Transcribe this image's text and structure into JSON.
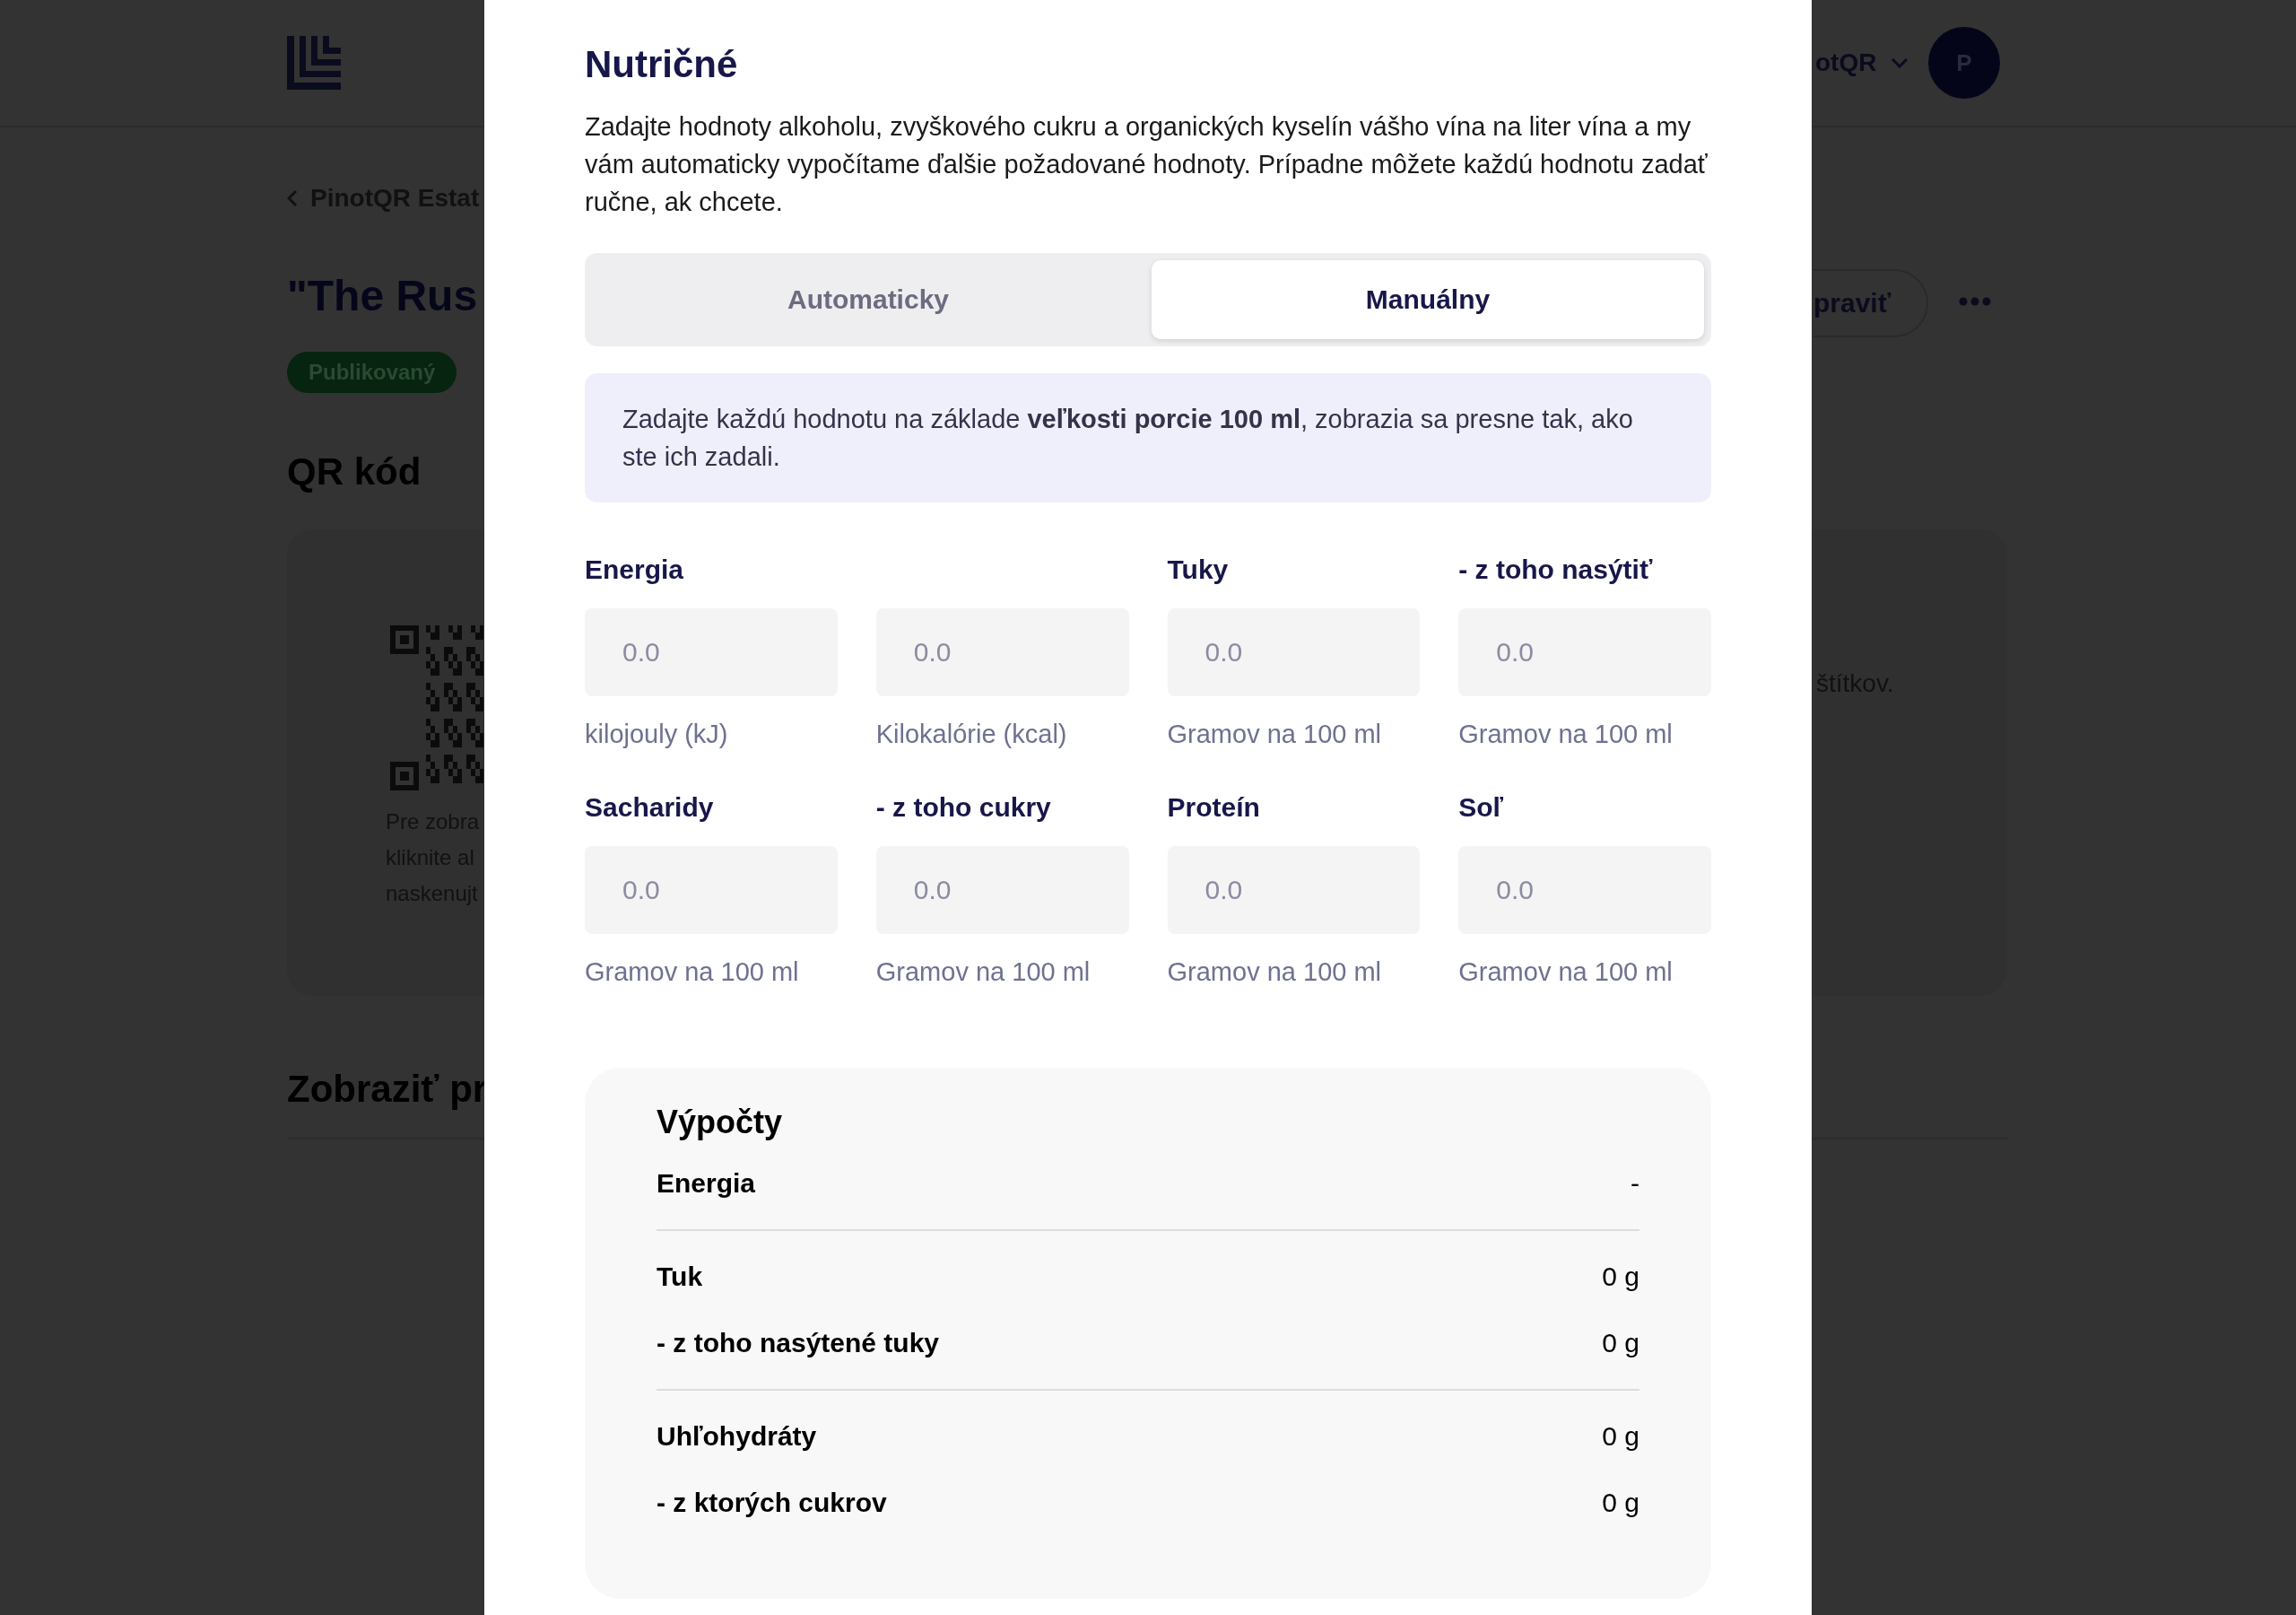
{
  "background": {
    "header": {
      "account_name": "otQR",
      "avatar_initial": "P"
    },
    "breadcrumb": "PinotQR Estat",
    "title": "\"The Rus",
    "status_badge": "Publikovaný",
    "edit_button": "praviť",
    "qr_section": {
      "heading": "QR kód",
      "description_lines": [
        "Pre zobra",
        "kliknite al",
        "naskenujt"
      ],
      "description_tail": "štítkov."
    },
    "preview_heading": "Zobraziť pr"
  },
  "modal": {
    "title": "Nutričné",
    "description": "Zadajte hodnoty alkoholu, zvyškového cukru a organických kyselín vášho vína na liter vína a my vám automaticky vypočítame ďalšie požadované hodnoty. Prípadne môžete každú hodnotu zadať ručne, ak chcete.",
    "mode_tabs": [
      {
        "label": "Automaticky",
        "selected": false
      },
      {
        "label": "Manuálny",
        "selected": true
      }
    ],
    "info": "Zadajte každú hodnotu na základe **veľkosti porcie 100 ml**, zobrazia sa presne tak, ako ste ich zadali.",
    "fields": [
      {
        "label": "Energia",
        "placeholder": "0.0",
        "hint": "kilojouly (kJ)"
      },
      {
        "placeholder": "0.0",
        "hint": "Kilokalórie (kcal)"
      },
      {
        "label": "Tuky",
        "placeholder": "0.0",
        "hint": "Gramov na 100 ml"
      },
      {
        "label": "- z toho nasýtiť",
        "placeholder": "0.0",
        "hint": "Gramov na 100 ml"
      },
      {
        "label": "Sacharidy",
        "placeholder": "0.0",
        "hint": "Gramov na 100 ml"
      },
      {
        "label": "- z toho cukry",
        "placeholder": "0.0",
        "hint": "Gramov na 100 ml"
      },
      {
        "label": "Proteín",
        "placeholder": "0.0",
        "hint": "Gramov na 100 ml"
      },
      {
        "label": "Soľ",
        "placeholder": "0.0",
        "hint": "Gramov na 100 ml"
      }
    ],
    "calculations": {
      "title": "Výpočty",
      "groups": [
        [
          {
            "label": "Energia",
            "value": "-"
          }
        ],
        [
          {
            "label": "Tuk",
            "value": "0 g"
          },
          {
            "label": "- z toho nasýtené tuky",
            "value": "0 g"
          }
        ],
        [
          {
            "label": "Uhľohydráty",
            "value": "0 g"
          },
          {
            "label": "- z ktorých cukrov",
            "value": "0 g"
          }
        ]
      ]
    }
  }
}
